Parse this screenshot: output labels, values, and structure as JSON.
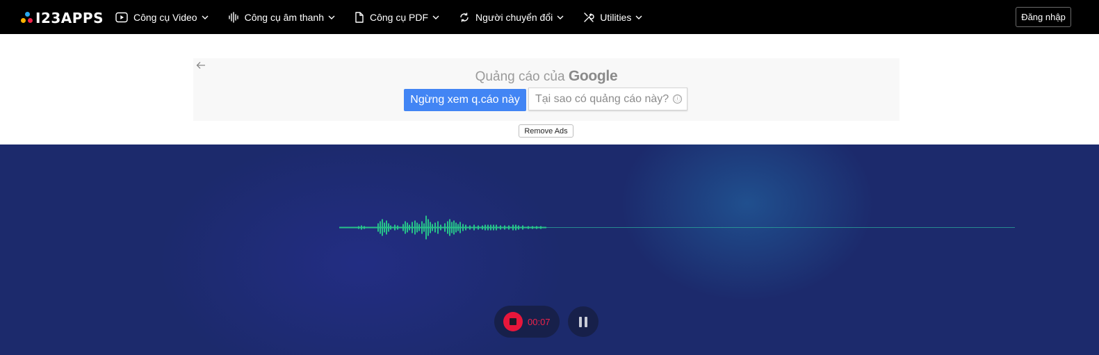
{
  "header": {
    "logo_text": "I23APPS",
    "nav": [
      {
        "label": "Công cụ Video",
        "icon": "video-play-icon"
      },
      {
        "label": "Công cụ âm thanh",
        "icon": "audio-wave-icon"
      },
      {
        "label": "Công cụ PDF",
        "icon": "document-icon"
      },
      {
        "label": "Người chuyển đổi",
        "icon": "convert-icon"
      },
      {
        "label": "Utilities",
        "icon": "tools-icon"
      }
    ],
    "login_label": "Đăng nhập"
  },
  "ad": {
    "title_prefix": "Quảng cáo của",
    "title_brand": "Google",
    "stop_label": "Ngừng xem q.cáo này",
    "why_label": "Tại sao có quảng cáo này?",
    "why_icon": "ⓘ",
    "remove_ads_label": "Remove Ads"
  },
  "recorder": {
    "timer": "00:07",
    "colors": {
      "background": "#1c2a6c",
      "waveform": "#27c28a",
      "record": "#e8163b"
    }
  }
}
